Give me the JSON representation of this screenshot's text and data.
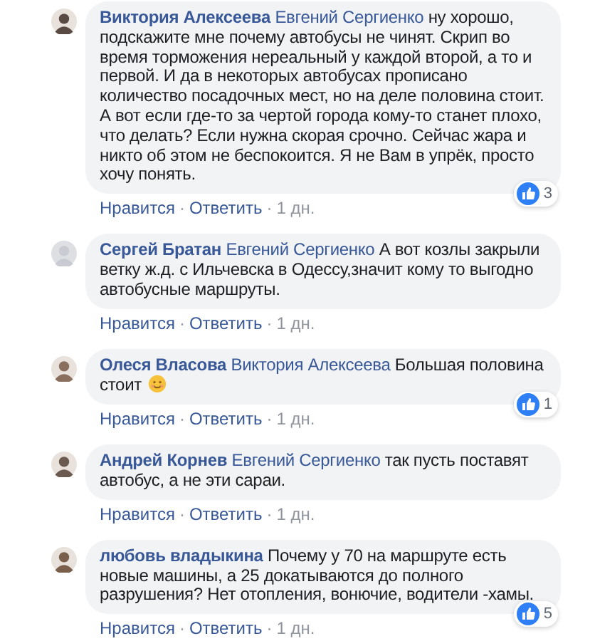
{
  "separator": "·",
  "comments": [
    {
      "author": "Виктория Алексеева",
      "mention": "Евгений Сергиенко",
      "text": "ну хорошо, подскажите мне почему автобусы не чинят. Скрип во время торможения нереальный у каждой второй, а то и первой. И да в некоторых автобусах прописано количество посадочных мест, но на деле половина стоит. А вот если где-то за чертой города кому-то станет плохо, что делать? Если нужна скорая срочно. Сейчас жара и никто об этом не беспокоится. Я не Вам в упрёк, просто хочу понять.",
      "emoji": false,
      "likes": "3",
      "actions": [
        "Нравится",
        "Ответить",
        "1 дн."
      ]
    },
    {
      "author": "Сергей Братан",
      "mention": "Евгений Сергиенко",
      "text": "А вот козлы закрыли ветку ж.д. с Ильчевска в Одессу,значит кому то выгодно автобусные маршруты.",
      "emoji": false,
      "actions": [
        "Нравится",
        "Ответить",
        "1 дн."
      ]
    },
    {
      "author": "Олеся Власова",
      "mention": "Виктория Алексеева",
      "text": "Большая половина стоит",
      "emoji": true,
      "likes": "1",
      "actions": [
        "Нравится",
        "Ответить",
        "1 дн."
      ]
    },
    {
      "author": "Андрей Корнев",
      "mention": "Евгений Сергиенко",
      "text": "так пусть поставят автобус, а не эти сараи.",
      "emoji": false,
      "actions": [
        "Нравится",
        "Ответить",
        "1 дн."
      ]
    },
    {
      "author": "любовь владыкина",
      "text": "Почему у 70 на маршруте есть новые машины, а 25 докатываются до полного разрушения? Нет отопления, вонючие, водители -хамы.",
      "emoji": false,
      "likes": "5",
      "actions": [
        "Нравится",
        "Ответить",
        "1 дн."
      ]
    }
  ]
}
